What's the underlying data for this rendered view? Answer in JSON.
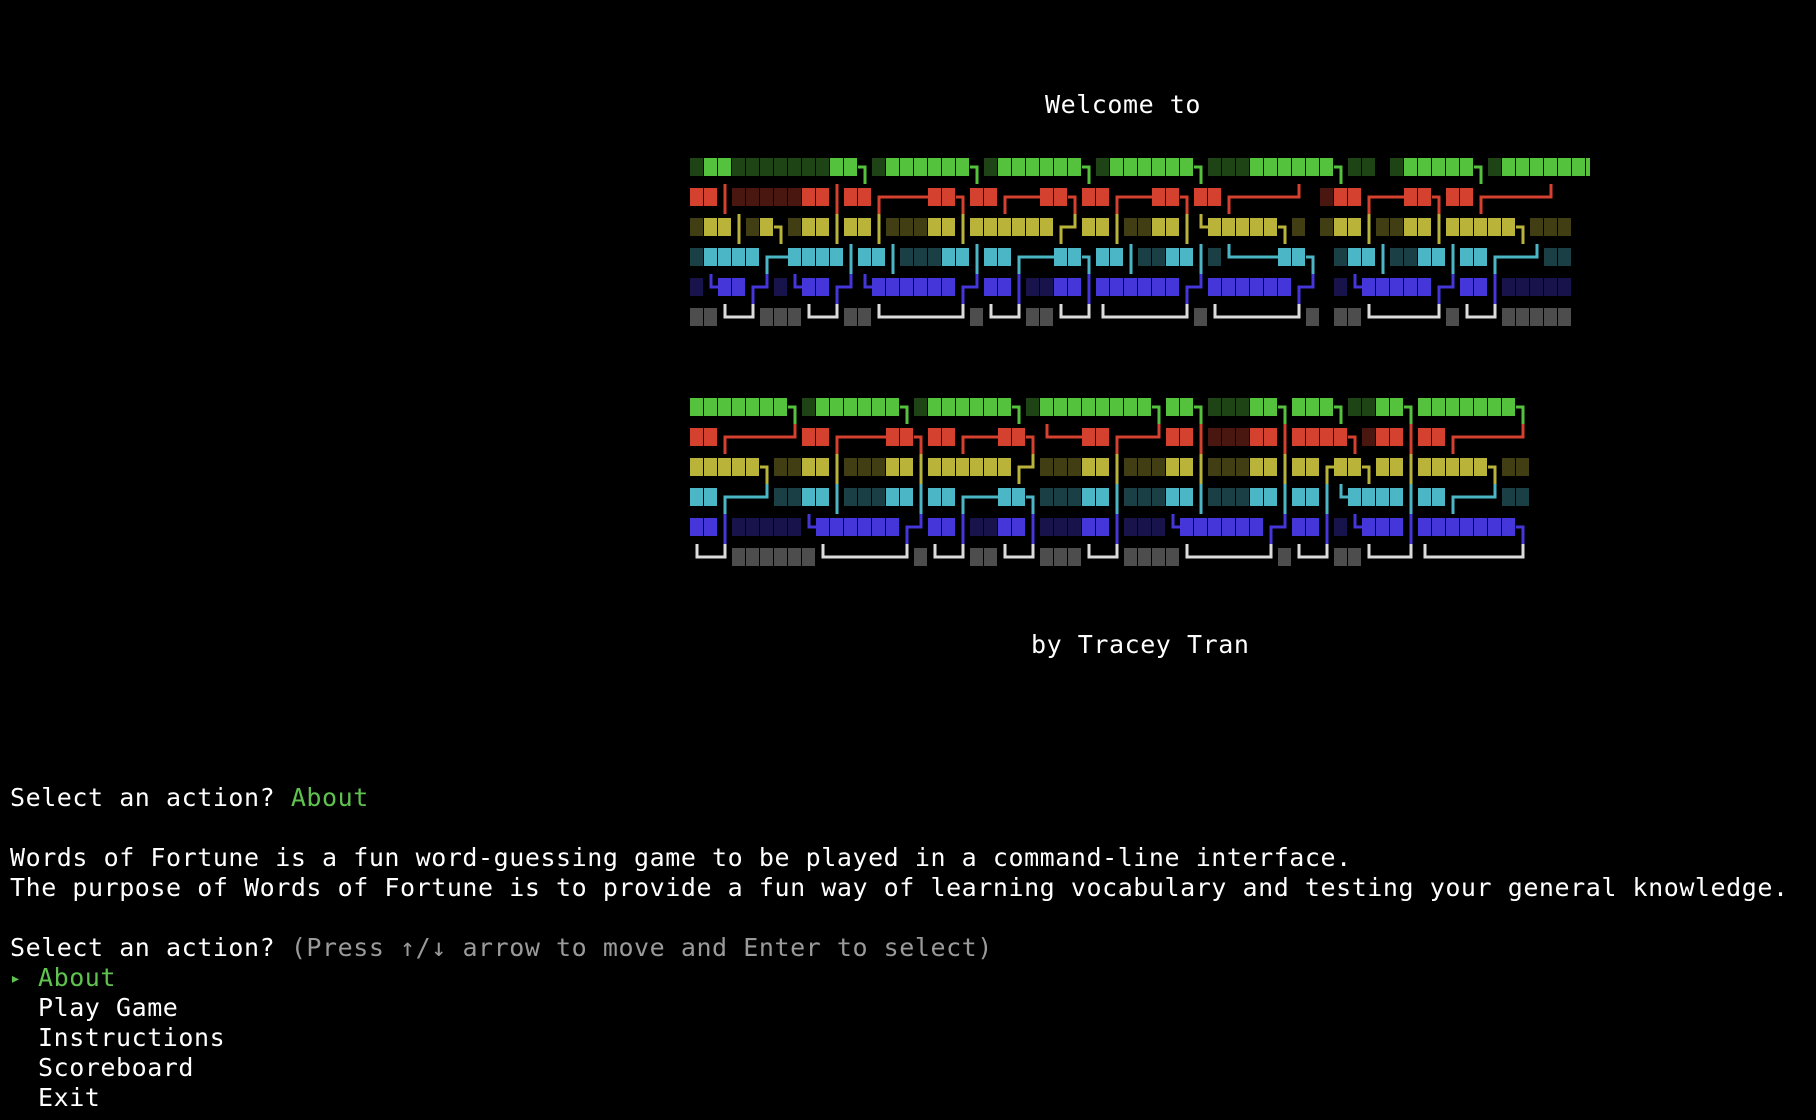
{
  "header": {
    "welcome": "Welcome to",
    "byline": "by Tracey Tran"
  },
  "banner": {
    "logo_text": "WORDS OF FORTUNE",
    "row_colors": [
      "#55c23e",
      "#d4412f",
      "#b9b33a",
      "#4ab6c6",
      "#4436d8",
      "#dcdcdc"
    ]
  },
  "prompt1": {
    "question": "Select an action? ",
    "answer": "About"
  },
  "about": {
    "line1": "Words of Fortune is a fun word-guessing game to be played in a command-line interface.",
    "line2": "The purpose of Words of Fortune is to provide a fun way of learning vocabulary and testing your general knowledge."
  },
  "prompt2": {
    "question": "Select an action? ",
    "hint": "(Press ↑/↓ arrow to move and Enter to select)"
  },
  "menu": {
    "pointer": "▸",
    "items": [
      {
        "label": "About"
      },
      {
        "label": "Play Game"
      },
      {
        "label": "Instructions"
      },
      {
        "label": "Scoreboard"
      },
      {
        "label": "Exit"
      }
    ]
  },
  "colors": {
    "background": "#000000",
    "text": "#ffffff",
    "accent": "#5fc24f",
    "hint": "#9a9a9a"
  }
}
